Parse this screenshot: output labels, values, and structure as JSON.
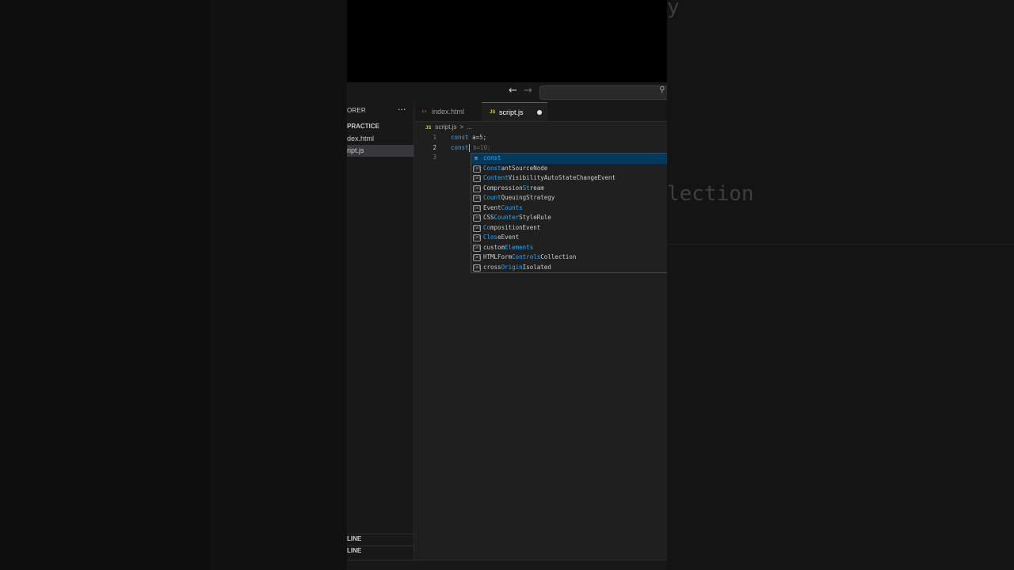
{
  "background": {
    "ghost_y": "y",
    "ghost_text": "lection"
  },
  "titlebar": {
    "back_icon": "←",
    "forward_icon": "→",
    "search_icon": "⚲"
  },
  "sidebar": {
    "header": "ORER",
    "more_icon": "···",
    "folder": "PRACTICE",
    "files": [
      "dex.html",
      "ript.js"
    ],
    "outline": "LINE",
    "timeline": "LINE"
  },
  "tabs": [
    {
      "icon": "‹›",
      "label": "index.html"
    },
    {
      "icon": "JS",
      "label": "script.js"
    }
  ],
  "breadcrumb": {
    "icon": "JS",
    "file": "script.js",
    "sep": ">",
    "rest": "..."
  },
  "editor": {
    "line_numbers": [
      "1",
      "2",
      "3"
    ],
    "line1": {
      "kw": "const",
      "var": "a",
      "eq": "=",
      "num": "5",
      "end": ";"
    },
    "line2": {
      "kw": "const",
      "ghost": " b=10;"
    }
  },
  "suggestions": [
    {
      "icon": "≡",
      "pre": "",
      "hl": "const",
      "post": ""
    },
    {
      "icon": "[ø]",
      "pre": "",
      "hl": "Const",
      "post": "antSourceNode"
    },
    {
      "icon": "[ø]",
      "pre": "",
      "hl": "Content",
      "post": "VisibilityAutoStateChangeEvent"
    },
    {
      "icon": "[ø]",
      "pre": "Compression",
      "hl": "St",
      "post": "ream"
    },
    {
      "icon": "[ø]",
      "pre": "",
      "hl": "Count",
      "post": "QueuingStrategy"
    },
    {
      "icon": "[ø]",
      "pre": "Event",
      "hl": "Counts",
      "post": ""
    },
    {
      "icon": "[ø]",
      "pre": "CSS",
      "hl": "Counter",
      "post": "StyleRule"
    },
    {
      "icon": "[ø]",
      "pre": "",
      "hl": "Co",
      "post": "mpositionEvent"
    },
    {
      "icon": "[ø]",
      "pre": "",
      "hl": "Clos",
      "post": "eEvent"
    },
    {
      "icon": "[ø]",
      "pre": "custom",
      "hl": "Elements",
      "post": ""
    },
    {
      "icon": "[ø]",
      "pre": "HTMLForm",
      "hl": "Controls",
      "post": "Collection"
    },
    {
      "icon": "[ø]",
      "pre": "cross",
      "hl": "Origin",
      "post": "Isolated"
    }
  ]
}
